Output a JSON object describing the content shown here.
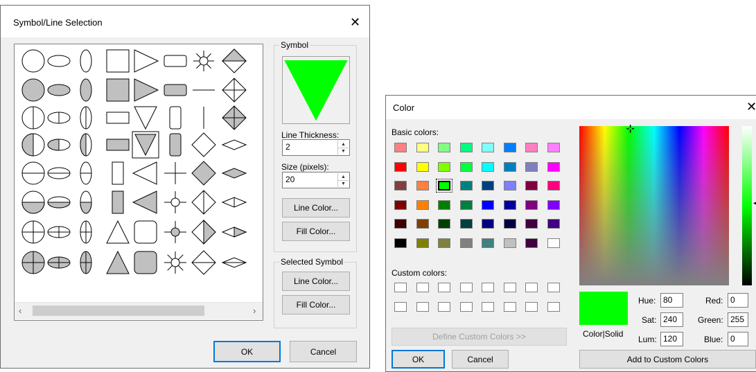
{
  "symbol_dialog": {
    "title": "Symbol/Line Selection",
    "symbol_group_label": "Symbol",
    "line_thickness_label": "Line Thickness:",
    "line_thickness_value": "2",
    "size_label": "Size (pixels):",
    "size_value": "20",
    "line_color_button": "Line Color...",
    "fill_color_button": "Fill Color...",
    "selected_symbol_group_label": "Selected Symbol",
    "selected_line_color_button": "Line Color...",
    "selected_fill_color_button": "Fill Color...",
    "ok_button": "OK",
    "cancel_button": "Cancel",
    "preview_color": "#00ff00",
    "selected_symbol": "triangle-down-filled"
  },
  "color_dialog": {
    "title": "Color",
    "basic_colors_label": "Basic colors:",
    "custom_colors_label": "Custom colors:",
    "define_custom_button": "Define Custom Colors >>",
    "ok_button": "OK",
    "cancel_button": "Cancel",
    "color_solid_label": "Color|Solid",
    "hue_label": "Hue:",
    "hue_value": "80",
    "sat_label": "Sat:",
    "sat_value": "240",
    "lum_label": "Lum:",
    "lum_value": "120",
    "red_label": "Red:",
    "red_value": "0",
    "green_label": "Green:",
    "green_value": "255",
    "blue_label": "Blue:",
    "blue_value": "0",
    "add_custom_button": "Add to Custom Colors",
    "current_color": "#00ff00",
    "basic_colors": [
      "#ff8080",
      "#ffff80",
      "#80ff80",
      "#00ff80",
      "#80ffff",
      "#0080ff",
      "#ff80c0",
      "#ff80ff",
      "#ff0000",
      "#ffff00",
      "#80ff00",
      "#00ff40",
      "#00ffff",
      "#0080c0",
      "#8080c0",
      "#ff00ff",
      "#804040",
      "#ff8040",
      "#00ff00",
      "#008080",
      "#004080",
      "#8080ff",
      "#800040",
      "#ff0080",
      "#800000",
      "#ff8000",
      "#008000",
      "#008040",
      "#0000ff",
      "#0000a0",
      "#800080",
      "#8000ff",
      "#400000",
      "#804000",
      "#004000",
      "#004040",
      "#000080",
      "#000040",
      "#400040",
      "#400080",
      "#000000",
      "#808000",
      "#808040",
      "#808080",
      "#408080",
      "#c0c0c0",
      "#400040",
      "#ffffff"
    ],
    "selected_basic_index": 18
  }
}
